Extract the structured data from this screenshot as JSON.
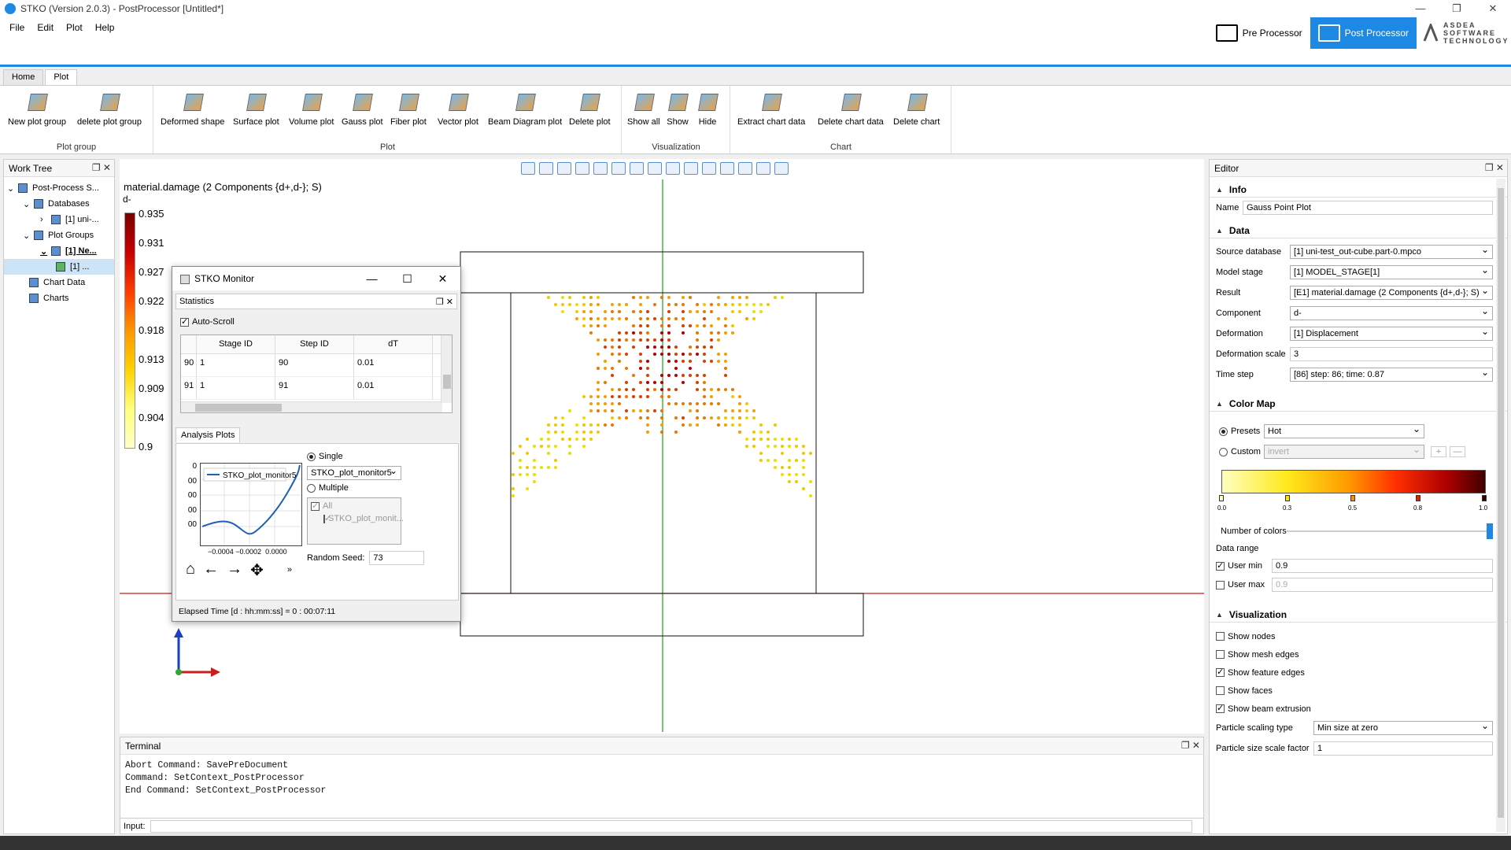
{
  "window": {
    "title": "STKO (Version 2.0.3) - PostProcessor [Untitled*]"
  },
  "menu": [
    "File",
    "Edit",
    "Plot",
    "Help"
  ],
  "context": {
    "pre": "Pre Processor",
    "post": "Post Processor",
    "brand": "ASDEA SOFTWARE TECHNOLOGY"
  },
  "ribbon": {
    "tabs": [
      "Home",
      "Plot"
    ],
    "groups": {
      "plot_group": {
        "label": "Plot group",
        "buttons": [
          "New plot group",
          "delete plot group"
        ]
      },
      "plot": {
        "label": "Plot",
        "buttons": [
          "Deformed shape",
          "Surface plot",
          "Volume plot",
          "Gauss plot",
          "Fiber plot",
          "Vector plot",
          "Beam Diagram plot",
          "Delete plot"
        ]
      },
      "visualization": {
        "label": "Visualization",
        "buttons": [
          "Show all",
          "Show",
          "Hide"
        ]
      },
      "chart": {
        "label": "Chart",
        "buttons": [
          "Extract chart data",
          "Delete chart data",
          "Delete chart"
        ]
      }
    }
  },
  "worktree": {
    "title": "Work Tree",
    "items": [
      "Post-Process S...",
      "Databases",
      "[1] uni-...",
      "Plot Groups",
      "[1] Ne...",
      "[1] ...",
      "Chart Data",
      "Charts"
    ]
  },
  "viewport": {
    "plot_title": "material.damage (2 Components {d+,d-}; S)",
    "colorbar_label": "d-",
    "colorbar_ticks": [
      "0.935",
      "0.931",
      "0.927",
      "0.922",
      "0.918",
      "0.913",
      "0.909",
      "0.904",
      "0.9"
    ]
  },
  "monitor": {
    "title": "STKO Monitor",
    "stats_title": "Statistics",
    "autoscroll": "Auto-Scroll",
    "columns": [
      "Stage ID",
      "Step ID",
      "dT"
    ],
    "rows": [
      {
        "idx": "90",
        "stage": "1",
        "step": "90",
        "dt": "0.01"
      },
      {
        "idx": "91",
        "stage": "1",
        "step": "91",
        "dt": "0.01"
      }
    ],
    "analysis_tab": "Analysis Plots",
    "legend": "STKO_plot_monitor5",
    "yticks": [
      "0",
      "00",
      "00",
      "00",
      "00"
    ],
    "xticks": "−0.0004 −0.0002  0.0000",
    "single": "Single",
    "single_value": "STKO_plot_monitor5",
    "multiple": "Multiple",
    "all": "All",
    "multi_item": "STKO_plot_monit...",
    "seed_label": "Random Seed:",
    "seed_value": "73",
    "elapsed": "Elapsed Time [d : hh:mm:ss] = 0 : 00:07:11"
  },
  "terminal": {
    "title": "Terminal",
    "lines": [
      "Abort Command: SavePreDocument",
      "Command: SetContext_PostProcessor",
      "End Command: SetContext_PostProcessor"
    ],
    "input_label": "Input:"
  },
  "editor": {
    "title": "Editor",
    "info": "Info",
    "name_label": "Name",
    "name_value": "Gauss Point Plot",
    "data": "Data",
    "fields": [
      {
        "label": "Source database",
        "value": "[1] uni-test_out-cube.part-0.mpco"
      },
      {
        "label": "Model stage",
        "value": "[1] MODEL_STAGE[1]"
      },
      {
        "label": "Result",
        "value": "[E1] material.damage (2 Components {d+,d-}; S)"
      },
      {
        "label": "Component",
        "value": "d-"
      },
      {
        "label": "Deformation",
        "value": "[1] Displacement"
      },
      {
        "label": "Deformation scale",
        "value": "3"
      },
      {
        "label": "Time step",
        "value": "[86] step: 86; time: 0.87"
      }
    ],
    "colormap": "Color Map",
    "presets_label": "Presets",
    "presets_value": "Hot",
    "custom_label": "Custom",
    "custom_value": "invert",
    "ramp_ticks": [
      "0.0",
      "0.3",
      "0.5",
      "0.8",
      "1.0"
    ],
    "num_colors": "Number of colors",
    "data_range": "Data range",
    "user_min_label": "User min",
    "user_min_value": "0.9",
    "user_max_label": "User max",
    "user_max_value": "0.9",
    "visualization": "Visualization",
    "checks": [
      {
        "label": "Show nodes",
        "on": false
      },
      {
        "label": "Show mesh edges",
        "on": false
      },
      {
        "label": "Show feature edges",
        "on": true
      },
      {
        "label": "Show faces",
        "on": false
      },
      {
        "label": "Show beam extrusion",
        "on": true
      }
    ],
    "scaling_label": "Particle scaling type",
    "scaling_value": "Min size at zero",
    "psf_label": "Particle size scale factor",
    "psf_value": "1"
  },
  "colors": {
    "accent": "#1e88e5",
    "x_axis": "#c81e1e",
    "y_axis": "#2ea82e",
    "z_axis": "#1a3fc4"
  }
}
